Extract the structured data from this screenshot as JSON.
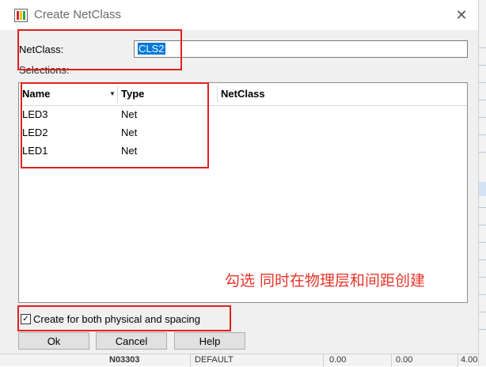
{
  "dialog": {
    "title": "Create NetClass",
    "close_glyph": "✕",
    "netclass_label": "NetClass:",
    "netclass_value": "CLS2",
    "selections_label": "Selections:"
  },
  "grid": {
    "columns": [
      "Name",
      "Type",
      "NetClass"
    ],
    "rows": [
      {
        "name": "LED3",
        "type": "Net"
      },
      {
        "name": "LED2",
        "type": "Net"
      },
      {
        "name": "LED1",
        "type": "Net"
      }
    ]
  },
  "annotation": {
    "text": "勾选 同时在物理层和间距创建",
    "color": "#e8352a"
  },
  "checkbox": {
    "checked": true,
    "glyph": "✓",
    "label": "Create  for both physical and spacing"
  },
  "buttons": {
    "ok": "Ok",
    "cancel": "Cancel",
    "help": "Help"
  },
  "background_app": {
    "bottom_cells": [
      "N03303",
      "DEFAULT",
      "0.00",
      "0.00",
      "4.00"
    ]
  },
  "colors": {
    "selection": "#0078d7",
    "annotation_border": "#e02020",
    "dialog_bg": "#f0f0f0"
  }
}
